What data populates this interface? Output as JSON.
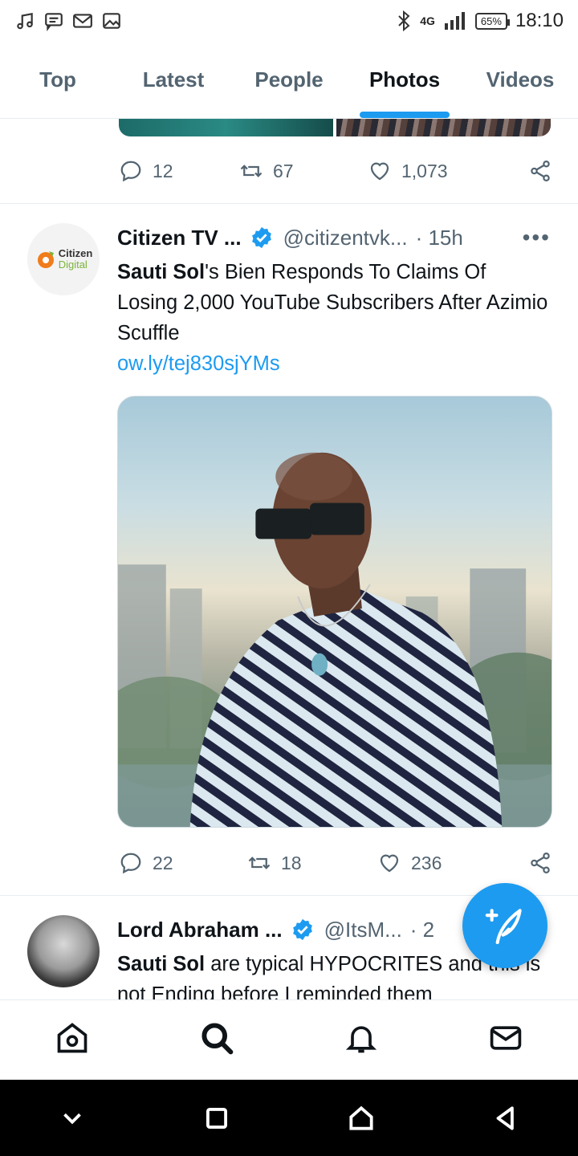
{
  "status_bar": {
    "time": "18:10",
    "battery": "65%",
    "network": "4G",
    "left_icons": [
      "music-icon",
      "message-icon",
      "gmail-icon",
      "image-icon"
    ]
  },
  "tabs": [
    {
      "label": "Top",
      "active": false
    },
    {
      "label": "Latest",
      "active": false
    },
    {
      "label": "People",
      "active": false
    },
    {
      "label": "Photos",
      "active": true
    },
    {
      "label": "Videos",
      "active": false
    }
  ],
  "prev_tweet": {
    "replies": "12",
    "retweets": "67",
    "likes": "1,073"
  },
  "tweet1": {
    "avatar_text_1": "Citizen",
    "avatar_text_2": "Digital",
    "name": "Citizen TV ...",
    "handle": "@citizentvk...",
    "time": "· 15h",
    "more": "•••",
    "text_bold": "Sauti Sol",
    "text_rest": "'s Bien Responds To Claims Of Losing 2,000 YouTube Subscribers After Azimio Scuffle",
    "link": "ow.ly/tej830sjYMs",
    "replies": "22",
    "retweets": "18",
    "likes": "236"
  },
  "tweet2": {
    "name": "Lord Abraham ...",
    "handle": "@ItsM...",
    "time": "· 2",
    "text_bold": "Sauti Sol",
    "text_rest": " are typical HYPOCRITES and this is not Ending before I reminded them"
  },
  "colors": {
    "accent": "#1d9bf0",
    "text": "#0f1419",
    "secondary": "#536471"
  }
}
